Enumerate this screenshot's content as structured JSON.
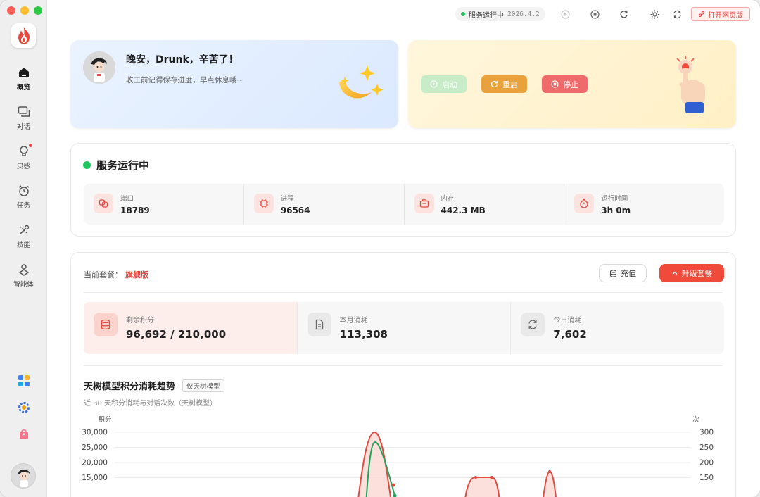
{
  "nav": {
    "items": [
      {
        "label": "概览",
        "icon": "home-icon"
      },
      {
        "label": "对话",
        "icon": "chat-icon"
      },
      {
        "label": "灵感",
        "icon": "lightbulb-icon"
      },
      {
        "label": "任务",
        "icon": "alarm-clock-icon"
      },
      {
        "label": "技能",
        "icon": "tools-icon"
      },
      {
        "label": "智能体",
        "icon": "agent-icon"
      }
    ]
  },
  "topbar": {
    "status": "服务运行中",
    "version": "2026.4.2",
    "open_web": "打开网页版"
  },
  "greeting": {
    "title": "晚安，Drunk，辛苦了！",
    "subtitle": "收工前记得保存进度，早点休息哦~"
  },
  "controls": {
    "start": "启动",
    "restart": "重启",
    "stop": "停止"
  },
  "service": {
    "title": "服务运行中",
    "metrics": [
      {
        "label": "端口",
        "value": "18789",
        "icon": "port-icon"
      },
      {
        "label": "进程",
        "value": "96564",
        "icon": "cpu-icon"
      },
      {
        "label": "内存",
        "value": "442.3 MB",
        "icon": "memory-icon"
      },
      {
        "label": "运行时间",
        "value": "3h 0m",
        "icon": "timer-icon"
      }
    ]
  },
  "plan": {
    "current_label": "当前套餐：",
    "current_value": "旗舰版",
    "recharge": "充值",
    "upgrade": "升级套餐",
    "credits": [
      {
        "label": "剩余积分",
        "value": "96,692 / 210,000",
        "icon": "database-icon"
      },
      {
        "label": "本月消耗",
        "value": "113,308",
        "icon": "document-icon"
      },
      {
        "label": "今日消耗",
        "value": "7,602",
        "icon": "refresh-icon"
      }
    ]
  },
  "chart": {
    "title": "天树模型积分消耗趋势",
    "tag": "仅天树模型",
    "subtitle": "近 30 天积分消耗与对话次数（天树模型）"
  },
  "chart_data": {
    "type": "line",
    "left_axis_label": "积分",
    "right_axis_label": "次",
    "left_ticks": [
      "30,000",
      "25,000",
      "20,000",
      "15,000"
    ],
    "right_ticks": [
      "300",
      "250",
      "200",
      "150"
    ],
    "ylim_left": [
      15000,
      30000
    ],
    "ylim_right": [
      150,
      300
    ],
    "colors": {
      "credits": "#e5483f",
      "conversations": "#22a55e"
    }
  }
}
